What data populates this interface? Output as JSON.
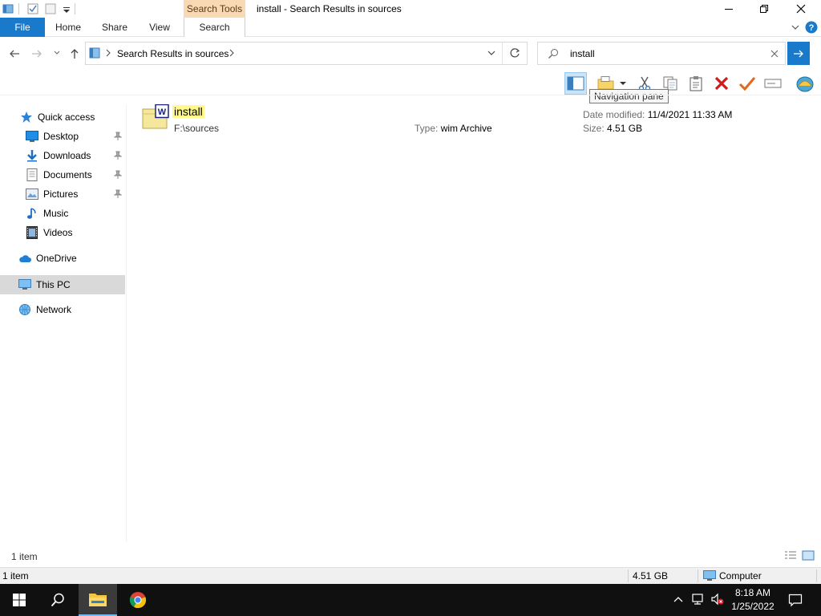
{
  "window": {
    "title": "install - Search Results in sources",
    "context_tab_group": "Search Tools"
  },
  "ribbon": {
    "tabs": [
      {
        "label": "File"
      },
      {
        "label": "Home"
      },
      {
        "label": "Share"
      },
      {
        "label": "View"
      },
      {
        "label": "Search"
      }
    ]
  },
  "address": {
    "breadcrumb": "Search Results in sources"
  },
  "search": {
    "value": "install"
  },
  "toolbar": {
    "tooltip": "Navigation pane"
  },
  "nav": {
    "quick_access": "Quick access",
    "items": [
      {
        "label": "Desktop",
        "icon": "desktop-icon"
      },
      {
        "label": "Downloads",
        "icon": "downloads-icon"
      },
      {
        "label": "Documents",
        "icon": "documents-icon"
      },
      {
        "label": "Pictures",
        "icon": "pictures-icon"
      },
      {
        "label": "Music",
        "icon": "music-icon"
      },
      {
        "label": "Videos",
        "icon": "videos-icon"
      }
    ],
    "onedrive": "OneDrive",
    "this_pc": "This PC",
    "network": "Network"
  },
  "results": [
    {
      "name": "install",
      "path": "F:\\sources",
      "type_label": "Type:",
      "type": "wim Archive",
      "date_label": "Date modified:",
      "date": "11/4/2021 11:33 AM",
      "size_label": "Size:",
      "size": "4.51 GB"
    }
  ],
  "itembar": {
    "count": "1 item"
  },
  "statusbar": {
    "count": "1 item",
    "size": "4.51 GB",
    "location": "Computer"
  },
  "taskbar": {
    "time": "8:18 AM",
    "date": "1/25/2022"
  },
  "colors": {
    "accent": "#1979ca",
    "context_tab": "#f9d9b3",
    "highlight": "#fff88a",
    "taskbar": "#101010"
  }
}
